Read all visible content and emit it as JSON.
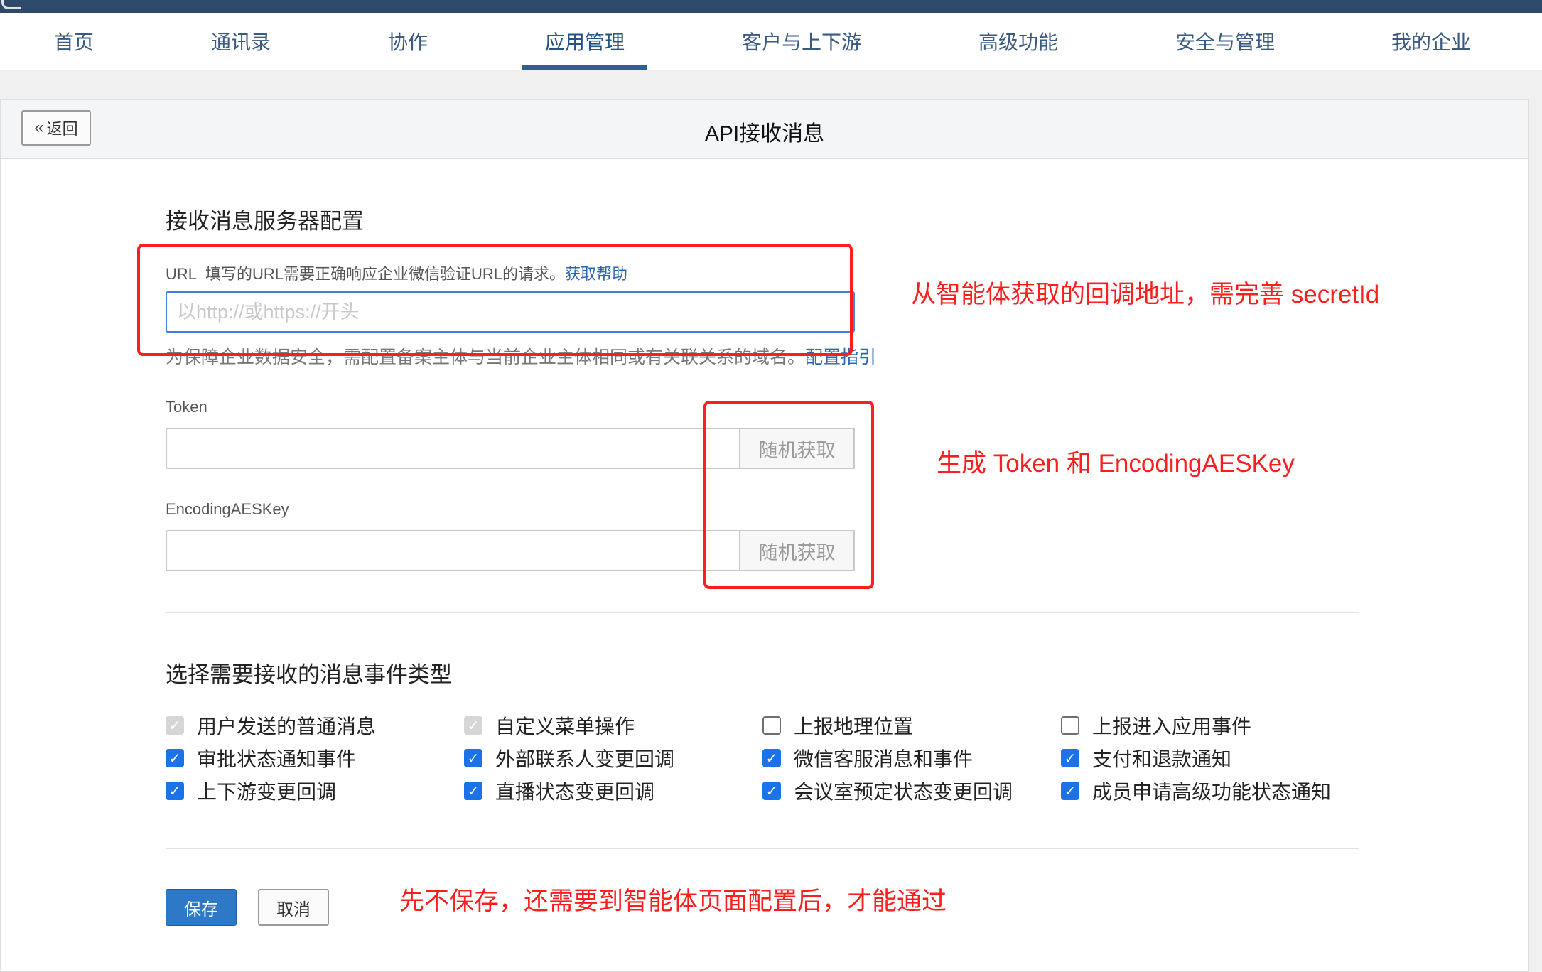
{
  "nav": {
    "items": [
      "首页",
      "通讯录",
      "协作",
      "应用管理",
      "客户与上下游",
      "高级功能",
      "安全与管理",
      "我的企业"
    ],
    "active": "应用管理"
  },
  "header": {
    "back_label": "返回",
    "back_icon": "double-chevron-left-icon",
    "title": "API接收消息"
  },
  "server_config": {
    "title": "接收消息服务器配置",
    "url_label": "URL",
    "url_desc": "填写的URL需要正确响应企业微信验证URL的请求。",
    "url_help_link": "获取帮助",
    "url_value": "",
    "url_placeholder": "以http://或https://开头",
    "hint": "为保障企业数据安全，需配置备案主体与当前企业主体相同或有关联关系的域名。",
    "hint_link": "配置指引",
    "token_label": "Token",
    "token_value": "",
    "token_button": "随机获取",
    "aeskey_label": "EncodingAESKey",
    "aeskey_value": "",
    "aeskey_button": "随机获取"
  },
  "events": {
    "title": "选择需要接收的消息事件类型",
    "items": [
      {
        "label": "用户发送的普通消息",
        "state": "checked-disabled"
      },
      {
        "label": "自定义菜单操作",
        "state": "checked-disabled"
      },
      {
        "label": "上报地理位置",
        "state": "unchecked"
      },
      {
        "label": "上报进入应用事件",
        "state": "unchecked"
      },
      {
        "label": "审批状态通知事件",
        "state": "checked"
      },
      {
        "label": "外部联系人变更回调",
        "state": "checked"
      },
      {
        "label": "微信客服消息和事件",
        "state": "checked"
      },
      {
        "label": "支付和退款通知",
        "state": "checked"
      },
      {
        "label": "上下游变更回调",
        "state": "checked"
      },
      {
        "label": "直播状态变更回调",
        "state": "checked"
      },
      {
        "label": "会议室预定状态变更回调",
        "state": "checked"
      },
      {
        "label": "成员申请高级功能状态通知",
        "state": "checked"
      }
    ]
  },
  "footer": {
    "save_label": "保存",
    "cancel_label": "取消"
  },
  "annotations": {
    "color": "#ff1e1e",
    "url_note": "从智能体获取的回调地址，需完善 secretId",
    "token_note": "生成 Token 和 EncodingAESKey",
    "save_note": "先不保存，还需要到智能体页面配置后，才能通过"
  }
}
